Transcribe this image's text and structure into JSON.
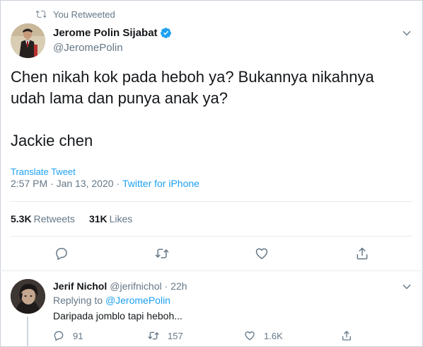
{
  "retweet_banner": {
    "label": "You Retweeted"
  },
  "tweet": {
    "author_name": "Jerome Polin Sijabat",
    "author_handle": "@JeromePolin",
    "text": "Chen nikah kok pada heboh ya? Bukannya nikahnya\nudah lama dan punya anak ya?\n\nJackie chen",
    "translate_label": "Translate Tweet",
    "timestamp": "2:57 PM · Jan 13, 2020",
    "separator": " · ",
    "source": "Twitter for iPhone",
    "retweets_count": "5.3K",
    "retweets_label": "Retweets",
    "likes_count": "31K",
    "likes_label": "Likes"
  },
  "reply": {
    "author_name": "Jerif Nichol",
    "author_handle": "@jerifnichol",
    "time": "· 22h",
    "replying_prefix": "Replying to",
    "replying_to": "@JeromePolin",
    "text": "Daripada jomblo tapi heboh...",
    "replies_count": "91",
    "retweets_count": "157",
    "likes_count": "1.6K"
  },
  "colors": {
    "accent": "#1da1f2",
    "muted": "#657786",
    "text": "#14171a",
    "border": "#e6ecf0"
  }
}
